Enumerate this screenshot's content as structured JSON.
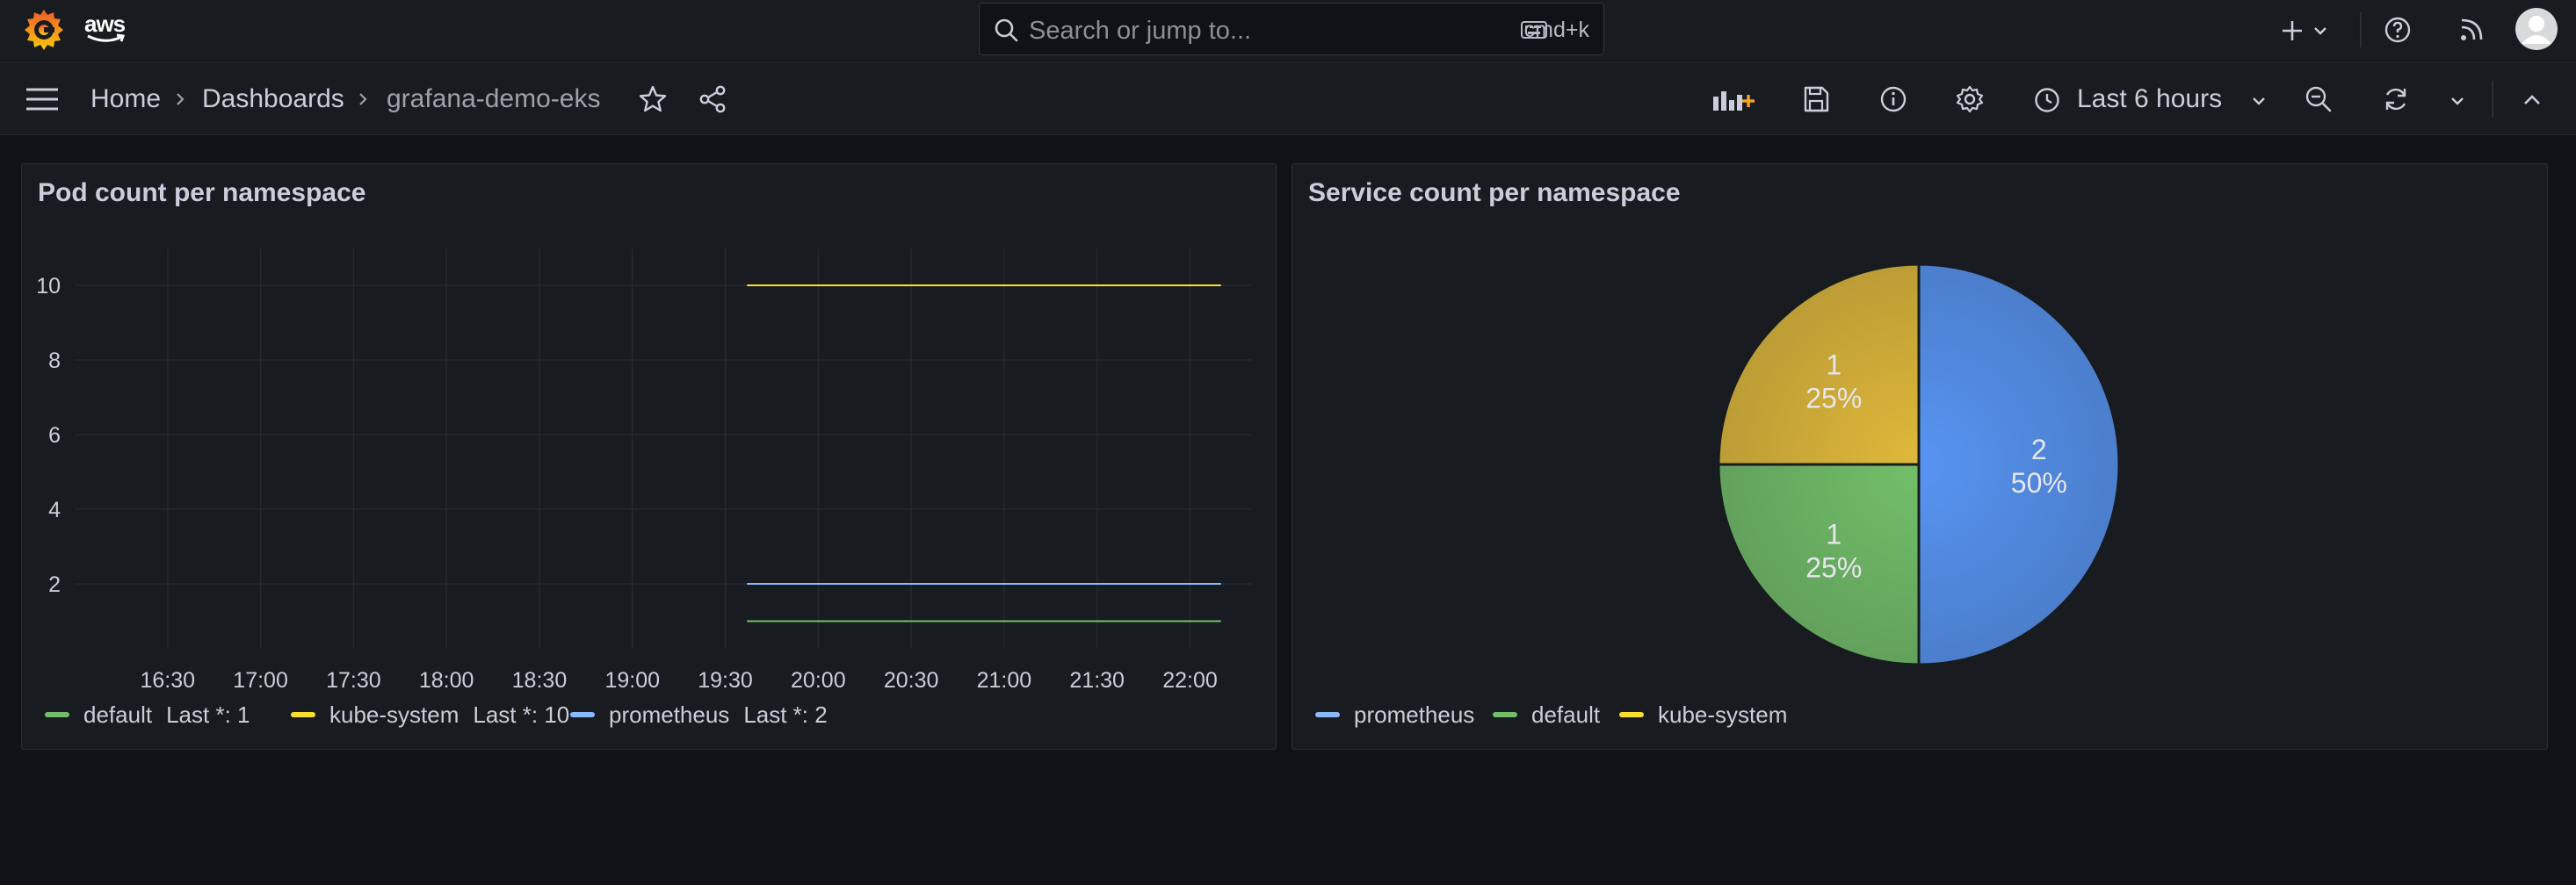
{
  "topbar": {
    "brand_text": "aws",
    "search_placeholder": "Search or jump to...",
    "search_shortcut": "cmd+k"
  },
  "breadcrumb": {
    "home": "Home",
    "dashboards": "Dashboards",
    "current": "grafana-demo-eks"
  },
  "toolbar": {
    "time_range": "Last 6 hours"
  },
  "panels": {
    "pods": {
      "title": "Pod count per namespace"
    },
    "services": {
      "title": "Service count per namespace"
    }
  },
  "colors": {
    "default": "#73bf69",
    "kube_system": "#fade2a",
    "prometheus": "#8ab8ff",
    "accent_orange": "#f5a623"
  },
  "chart_data": [
    {
      "type": "line",
      "title": "Pod count per namespace",
      "x_ticks": [
        "16:30",
        "17:00",
        "17:30",
        "18:00",
        "18:30",
        "19:00",
        "19:30",
        "20:00",
        "20:30",
        "21:00",
        "21:30",
        "22:00"
      ],
      "y_ticks": [
        2,
        4,
        6,
        8,
        10
      ],
      "grid": true,
      "legend_position": "bottom-left",
      "series": [
        {
          "name": "default",
          "color": "#73bf69",
          "x": [
            "19:37",
            "22:10"
          ],
          "values": [
            1,
            1
          ],
          "legend_stat": "Last *: 1"
        },
        {
          "name": "kube-system",
          "color": "#fade2a",
          "x": [
            "19:37",
            "22:10"
          ],
          "values": [
            10,
            10
          ],
          "legend_stat": "Last *: 10"
        },
        {
          "name": "prometheus",
          "color": "#8ab8ff",
          "x": [
            "19:37",
            "22:10"
          ],
          "values": [
            2,
            2
          ],
          "legend_stat": "Last *: 2"
        }
      ]
    },
    {
      "type": "pie",
      "title": "Service count per namespace",
      "legend_position": "bottom-left",
      "slices": [
        {
          "label": "prometheus",
          "value": 2,
          "percent": "50%",
          "color": "#5794f2"
        },
        {
          "label": "default",
          "value": 1,
          "percent": "25%",
          "color": "#73bf69"
        },
        {
          "label": "kube-system",
          "value": 1,
          "percent": "25%",
          "color": "#e0b93a"
        }
      ]
    }
  ]
}
